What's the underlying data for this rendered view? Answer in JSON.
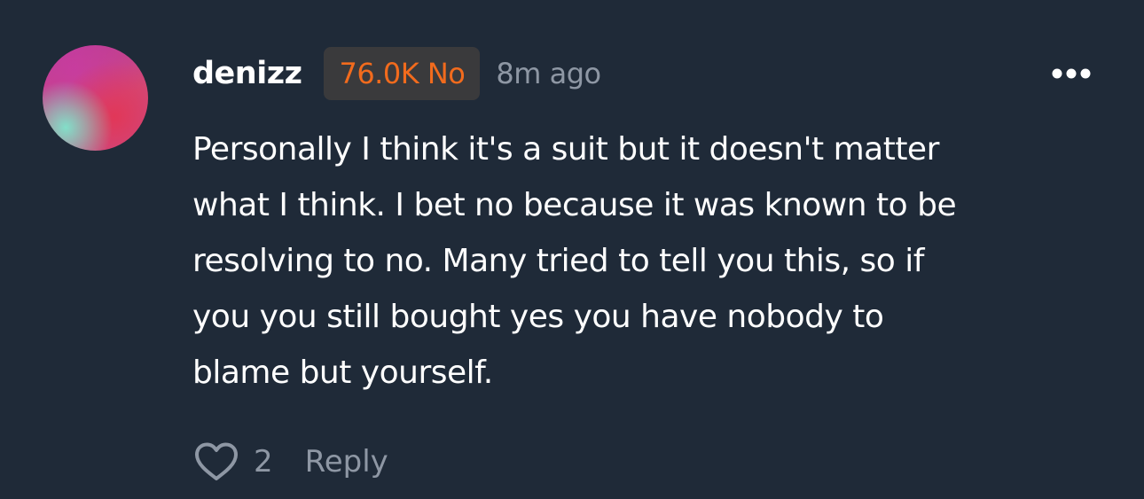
{
  "comment": {
    "avatar": "user-avatar",
    "username": "denizz",
    "position_badge": "76.0K No",
    "timestamp": "8m ago",
    "body_lines": [
      "Personally I think it's a suit but it doesn't matter",
      "what I think. I bet no because it was known to be",
      "resolving to no. Many tried to tell you this, so if",
      "you you still bought yes you have nobody to",
      "blame but yourself."
    ],
    "like_icon": "heart-icon",
    "like_count": "2",
    "reply_label": "Reply",
    "more_icon": "more-horizontal-icon"
  },
  "colors": {
    "background": "#1f2a38",
    "badge_background": "#3a3a3c",
    "badge_text": "#f26b1d",
    "muted_text": "#8e97a4",
    "primary_text": "#ffffff"
  }
}
